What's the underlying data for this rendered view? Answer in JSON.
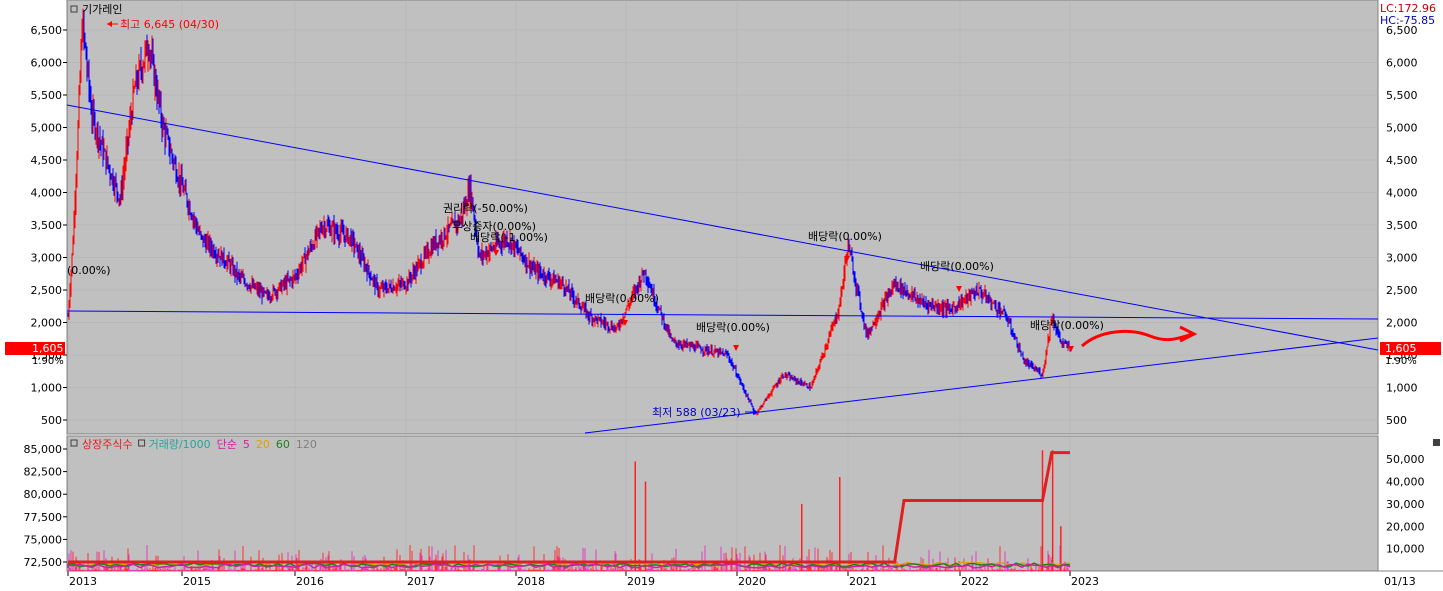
{
  "window": {
    "title": "기가레인",
    "lc_label": "LC:172.96",
    "hc_label": "HC:-75.85"
  },
  "price_panel": {
    "current_price_left": "1,605",
    "current_pct_left": "1.90%",
    "current_price_right": "1,605",
    "current_pct_right": "1.90%",
    "high_annotation": "최고 6,645 (04/30)",
    "low_annotation": "최저 588 (03/23)",
    "left_annotation": "(0.00%)",
    "events": [
      {
        "label": "권리락(-50.00%)"
      },
      {
        "label": "무상증자(0.00%)"
      },
      {
        "label": "배당락(-1.00%)"
      },
      {
        "label": "배당락(0.00%)"
      },
      {
        "label": "배당락(0.00%)"
      },
      {
        "label": "배당락(0.00%)"
      },
      {
        "label": "배당락(0.00%)"
      },
      {
        "label": "배당락(0.00%)"
      }
    ],
    "y_ticks": [
      "6,500",
      "6,000",
      "5,500",
      "5,000",
      "4,500",
      "4,000",
      "3,500",
      "3,000",
      "2,500",
      "2,000",
      "1,500",
      "1,000",
      "500"
    ]
  },
  "volume_panel": {
    "legend": [
      {
        "label": "상장주식수",
        "color": "#e02020"
      },
      {
        "label": "거래량/1000",
        "color": "#2aa198"
      },
      {
        "label": "단순",
        "color": "#d020a0"
      },
      {
        "label": "5",
        "color": "#d020a0"
      },
      {
        "label": "20",
        "color": "#e0a000"
      },
      {
        "label": "60",
        "color": "#208020"
      },
      {
        "label": "120",
        "color": "#808080"
      }
    ],
    "left_ticks": [
      "85,000",
      "82,500",
      "80,000",
      "77,500",
      "75,000",
      "72,500"
    ],
    "right_ticks": [
      "50,000",
      "40,000",
      "30,000",
      "20,000",
      "10,000"
    ]
  },
  "x_axis": {
    "ticks": [
      "2013",
      "2015",
      "2016",
      "2017",
      "2018",
      "2019",
      "2020",
      "2021",
      "2022",
      "2023"
    ],
    "right_label": "01/13"
  },
  "colors": {
    "plot_bg": "#c0c0c0",
    "up": "#ff0000",
    "down": "#0000ff",
    "trendline": "#0000ff",
    "listed_shares": "#e02020"
  },
  "chart_data": [
    {
      "type": "line",
      "title": "기가레인",
      "xlabel": "",
      "ylabel": "",
      "ylim": [
        400,
        6700
      ],
      "x_ticks": [
        "2013",
        "2015",
        "2016",
        "2017",
        "2018",
        "2019",
        "2020",
        "2021",
        "2022",
        "2023"
      ],
      "series": [
        {
          "name": "",
          "x": [
            "2013-01",
            "2013-02",
            "2013-03",
            "2013-04",
            "2013-06",
            "2013-09",
            "2013-12",
            "2014-03",
            "2014-06",
            "2014-09",
            "2014-12",
            "2015-03",
            "2015-06",
            "2015-07",
            "2015-10",
            "2016-01",
            "2016-04",
            "2016-07",
            "2016-10",
            "2017-01",
            "2017-04",
            "2017-07",
            "2017-08",
            "2017-09",
            "2017-12",
            "2018-03",
            "2018-06",
            "2018-09",
            "2018-12",
            "2019-03",
            "2019-04",
            "2019-06",
            "2019-09",
            "2019-12",
            "2020-03",
            "2020-06",
            "2020-09",
            "2020-12",
            "2021-01",
            "2021-03",
            "2021-06",
            "2021-09",
            "2021-12",
            "2022-03",
            "2022-06",
            "2022-08",
            "2022-09",
            "2022-10",
            "2022-11",
            "2022-12",
            "2023-01"
          ],
          "values": [
            2100,
            3200,
            4800,
            6645,
            5200,
            4500,
            3900,
            5600,
            6300,
            5000,
            4300,
            3300,
            2900,
            2700,
            2400,
            2700,
            3500,
            3300,
            2500,
            2600,
            3200,
            3600,
            4100,
            3000,
            3300,
            2800,
            2600,
            2100,
            1900,
            2800,
            2400,
            1700,
            1600,
            1500,
            588,
            1200,
            1000,
            2200,
            3200,
            1800,
            2600,
            2300,
            2200,
            2500,
            2100,
            1400,
            1300,
            1200,
            2100,
            1700,
            1605
          ]
        }
      ],
      "annotations": [
        "최고 6,645 (04/30)",
        "최저 588 (03/23)"
      ]
    },
    {
      "type": "bar",
      "title": "",
      "xlabel": "",
      "ylabel": "",
      "ylim_left": [
        72500,
        85000
      ],
      "ylim_right": [
        0,
        55000
      ],
      "series": [
        {
          "name": "상장주식수",
          "x": [
            "2013-01",
            "2021-06",
            "2021-07",
            "2022-10",
            "2022-11",
            "2023-01"
          ],
          "values": [
            72500,
            72500,
            79300,
            79300,
            84600,
            84600
          ]
        },
        {
          "name": "거래량/1000",
          "x": [
            "2019-02",
            "2019-03",
            "2020-08",
            "2020-12",
            "2022-10",
            "2022-11",
            "2022-12"
          ],
          "values": [
            49000,
            40000,
            30000,
            42000,
            54000,
            54000,
            20000
          ]
        }
      ]
    }
  ]
}
